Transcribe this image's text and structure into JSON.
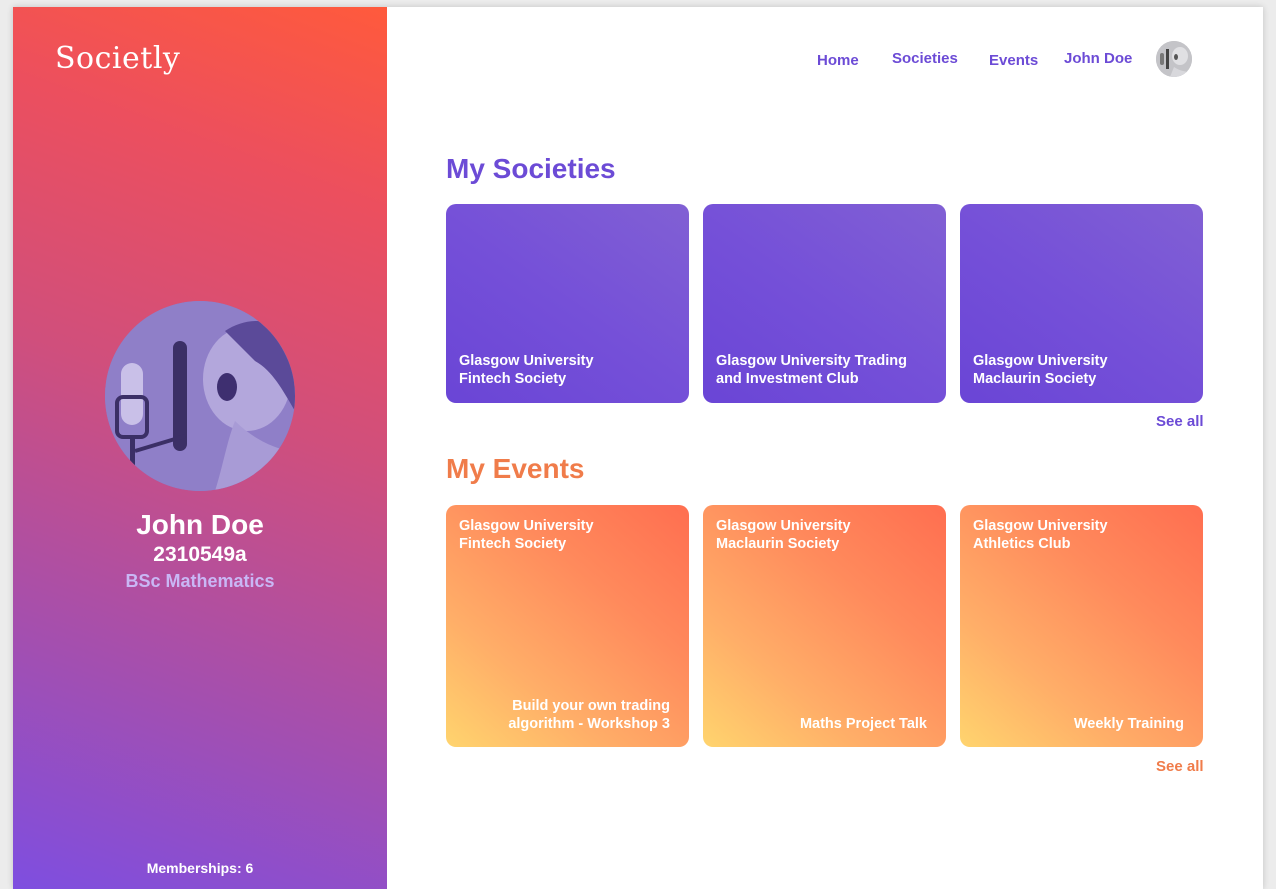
{
  "app": {
    "brand": "Societly"
  },
  "nav": {
    "items": [
      {
        "label": "Home"
      },
      {
        "label": "Societies"
      },
      {
        "label": "Events"
      },
      {
        "label": "John Doe"
      }
    ]
  },
  "profile": {
    "name": "John Doe",
    "id": "2310549a",
    "course": "BSc Mathematics",
    "memberships": "Memberships: 6"
  },
  "societies": {
    "title": "My Societies",
    "see_all": "See all",
    "items": [
      {
        "name": "Glasgow University\nFintech Society"
      },
      {
        "name": "Glasgow University Trading\nand Investment Club"
      },
      {
        "name": "Glasgow University\nMaclaurin Society"
      }
    ]
  },
  "events": {
    "title": "My Events",
    "see_all": "See all",
    "items": [
      {
        "society": "Glasgow University\nFintech Society",
        "event": "Build your own trading\nalgorithm - Workshop 3"
      },
      {
        "society": "Glasgow University\nMaclaurin Society",
        "event": "Maths Project Talk"
      },
      {
        "society": "Glasgow University\nAthletics Club",
        "event": "Weekly Training"
      }
    ]
  },
  "colors": {
    "accent_purple": "#6c4bd6",
    "accent_orange": "#f07c4a"
  }
}
